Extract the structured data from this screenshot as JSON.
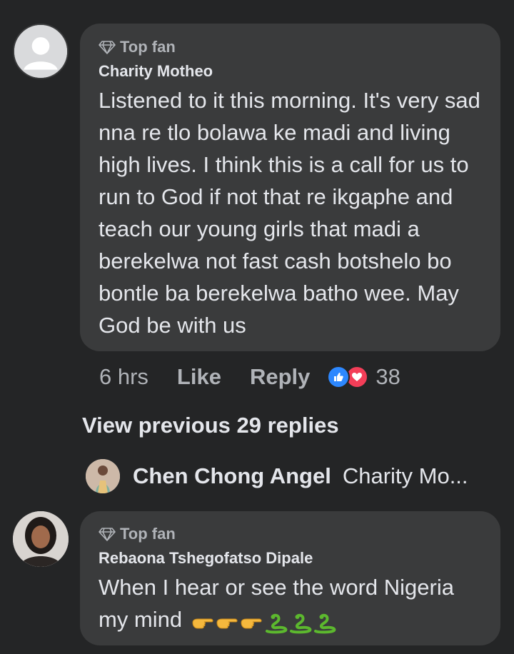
{
  "comment": {
    "badge": "Top fan",
    "author": "Charity Motheo",
    "text": "Listened to it this morning. It's very sad nna re tlo bolawa ke madi and living high lives. I think this is a call for us to run to God if not that re ikgaphe and teach our young girls that madi a berekelwa not fast cash botshelo bo bontle ba berekelwa batho wee. May God be with us",
    "time": "6 hrs",
    "like_label": "Like",
    "reply_label": "Reply",
    "reaction_count": "38",
    "reaction_icons": [
      "like-icon",
      "love-icon"
    ]
  },
  "view_previous": "View previous 29 replies",
  "latest_reply": {
    "author": "Chen Chong Angel",
    "snippet": "Charity Mo..."
  },
  "reply_comment": {
    "badge": "Top fan",
    "author": "Rebaona Tshegofatso Dipale",
    "text": "When I hear or see the word Nigeria my mind",
    "emojis": [
      "pointing-right-emoji",
      "pointing-right-emoji",
      "pointing-right-emoji",
      "snake-emoji",
      "snake-emoji",
      "snake-emoji"
    ]
  },
  "colors": {
    "background": "#242526",
    "bubble": "#3a3b3c",
    "text_primary": "#e4e6eb",
    "text_secondary": "#b0b3b8",
    "like_blue": "#2d88ff",
    "love_red": "#f33e58"
  }
}
